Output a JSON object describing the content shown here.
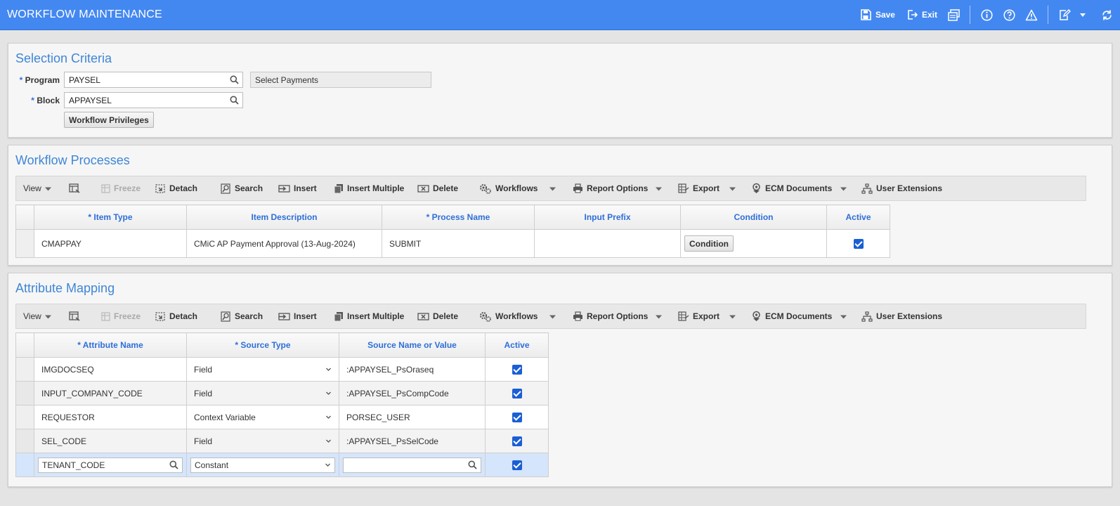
{
  "header": {
    "title": "WORKFLOW MAINTENANCE",
    "save_label": "Save",
    "exit_label": "Exit",
    "icons": [
      "save-icon",
      "exit-icon",
      "print-icon",
      "info-icon",
      "help-icon",
      "warning-icon",
      "edit-icon",
      "chevron-down-icon",
      "refresh-icon"
    ],
    "bg_color": "#4388f1"
  },
  "selection": {
    "title": "Selection Criteria",
    "program_label": "Program",
    "program_value": "PAYSEL",
    "program_desc": "Select Payments",
    "block_label": "Block",
    "block_value": "APPAYSEL",
    "privileges_button": "Workflow Privileges"
  },
  "toolbar": {
    "view": "View",
    "freeze": "Freeze",
    "detach": "Detach",
    "search": "Search",
    "insert": "Insert",
    "insert_multiple": "Insert Multiple",
    "delete": "Delete",
    "workflows": "Workflows",
    "report_options": "Report Options",
    "export": "Export",
    "ecm_documents": "ECM Documents",
    "user_extensions": "User Extensions"
  },
  "processes": {
    "title": "Workflow Processes",
    "columns": [
      "* Item Type",
      "Item Description",
      "* Process Name",
      "Input Prefix",
      "Condition",
      "Active"
    ],
    "rows": [
      {
        "item_type": "CMAPPAY",
        "description": "CMiC AP Payment Approval (13-Aug-2024)",
        "process_name": "SUBMIT",
        "input_prefix": "",
        "condition_button": "Condition",
        "active": true
      }
    ]
  },
  "mapping": {
    "title": "Attribute Mapping",
    "columns": [
      "* Attribute Name",
      "* Source Type",
      "Source Name or Value",
      "Active"
    ],
    "rows": [
      {
        "attribute": "IMGDOCSEQ",
        "source_type": "Field",
        "source_value": ":APPAYSEL_PsOraseq",
        "active": true
      },
      {
        "attribute": "INPUT_COMPANY_CODE",
        "source_type": "Field",
        "source_value": ":APPAYSEL_PsCompCode",
        "active": true
      },
      {
        "attribute": "REQUESTOR",
        "source_type": "Context Variable",
        "source_value": "PORSEC_USER",
        "active": true
      },
      {
        "attribute": "SEL_CODE",
        "source_type": "Field",
        "source_value": ":APPAYSEL_PsSelCode",
        "active": true
      },
      {
        "attribute": "TENANT_CODE",
        "source_type": "Constant",
        "source_value": "",
        "active": true
      }
    ]
  }
}
